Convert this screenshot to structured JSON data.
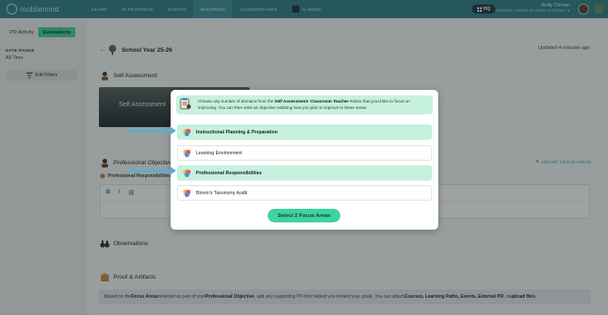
{
  "topbar": {
    "logo_text": "mobilemind",
    "nav": [
      "LEARN",
      "IN PROGRESS",
      "EVENTS",
      "BACKPACK",
      "LEADERBOARDS",
      "AI MODE"
    ],
    "active_index": 3,
    "hq_label": "HQ",
    "user_name": "Andy Clonan",
    "user_district": "CHERRY CREEK SCHOOL DISTRICT"
  },
  "sidebar": {
    "tabs": [
      "PD Activity",
      "Evaluations"
    ],
    "active_tab": 1,
    "date_range_label": "DATE RANGE",
    "date_range_value": "All Time",
    "filters_label": "Edit Filters"
  },
  "main": {
    "year_title": "School Year 25-26",
    "updated": "Updated 4 minutes ago",
    "self_assessment_title": "Self Assessment",
    "self_assessment_card_title": "Self Assessment",
    "professional_objective_title": "Professional Objective",
    "professional_responsibilities_sub": "Professional Responsibilities",
    "adjust_label": "ADJUST FOCUS AREAS",
    "observations_title": "Observations",
    "proof_title": "Proof & Artifacts",
    "note_prefix": "Based on the ",
    "note_focus": "Focus Areas",
    "note_mid1": " selected as part of your ",
    "note_po": "Professional Objective",
    "note_mid2": ", add any supporting PD that helped you toward your goals. You can attach ",
    "note_items": "Courses, Learning Paths, Events, External PD",
    "note_or": ", or ",
    "note_upload": "upload files",
    "note_end": "."
  },
  "modal": {
    "intro_pre": "Choose any number of domains from the ",
    "intro_bold": "Self Assessment- Classroom Teacher",
    "intro_post": " Rubric that you'd like to focus on improving. You can then write an objective outlining how you plan to improve in these areas.",
    "options": [
      {
        "label": "Instructional Planning & Preparation",
        "selected": true
      },
      {
        "label": "Learning Environment",
        "selected": false
      },
      {
        "label": "Professional Responsibilities",
        "selected": true
      },
      {
        "label": "Bloom's Taxonomy Audit",
        "selected": false
      }
    ],
    "select_button": "Select 2 Focus Areas"
  },
  "colors": {
    "nav": "#2f7e86",
    "accent": "#3fd2a0",
    "selected_bg": "#c6f1de",
    "arrow": "#58aed0"
  }
}
